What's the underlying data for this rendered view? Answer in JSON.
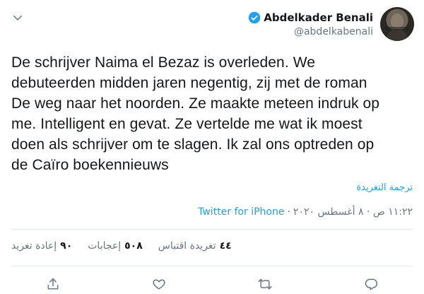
{
  "author": {
    "display_name": "Abdelkader Benali",
    "handle": "@abdelkabenali",
    "avatar_icon": "avatar-portrait",
    "verified_icon": "verified-badge-icon"
  },
  "tweet": {
    "text": "De schrijver Naima el Bezaz is overleden. We\ndebuteerden midden jaren negentig, zij met de roman\nDe weg naar het noorden. Ze maakte meteen indruk op\nme. Intelligent en gevat. Ze vertelde me wat ik moest\ndoen als schrijver om te slagen. Ik zal ons optreden op\nde Caïro boekennieuws",
    "translate_label": "ترجمة التغريدة"
  },
  "meta": {
    "time": "١١:٢٢ ص · ٨ أغسطس ٢٠٢٠",
    "separator": "·",
    "source": "Twitter for iPhone"
  },
  "stats": {
    "retweets_count": "٩٠",
    "retweets_label": "إعادة تغريد",
    "likes_count": "٥٠٨",
    "likes_label": "إعجابات",
    "quotes_count": "٤٤",
    "quotes_label": "تغريدة اقتباس"
  },
  "colors": {
    "accent": "#1da1f2",
    "secondary_text": "#657786",
    "divider": "#e1e8ed"
  }
}
